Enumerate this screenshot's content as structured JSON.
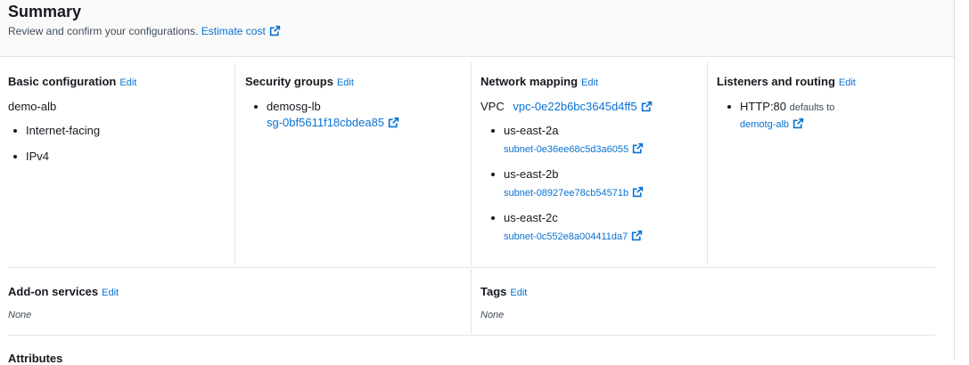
{
  "summary": {
    "title": "Summary",
    "subtitle": "Review and confirm your configurations.",
    "estimate_link": "Estimate cost"
  },
  "edit_label": "Edit",
  "basic": {
    "heading": "Basic configuration",
    "name": "demo-alb",
    "items": [
      "Internet-facing",
      "IPv4"
    ]
  },
  "security": {
    "heading": "Security groups",
    "group_name": "demosg-lb",
    "group_id": "sg-0bf5611f18cbdea85"
  },
  "network": {
    "heading": "Network mapping",
    "vpc_label": "VPC",
    "vpc_id": "vpc-0e22b6bc3645d4ff5",
    "zones": [
      {
        "zone": "us-east-2a",
        "subnet": "subnet-0e36ee68c5d3a6055"
      },
      {
        "zone": "us-east-2b",
        "subnet": "subnet-08927ee78cb54571b"
      },
      {
        "zone": "us-east-2c",
        "subnet": "subnet-0c552e8a004411da7"
      }
    ]
  },
  "listeners": {
    "heading": "Listeners and routing",
    "listener": "HTTP:80",
    "defaults_to": "defaults to",
    "target": "demotg-alb"
  },
  "addons": {
    "heading": "Add-on services",
    "value": "None"
  },
  "tags": {
    "heading": "Tags",
    "value": "None"
  },
  "attributes": {
    "heading": "Attributes"
  }
}
